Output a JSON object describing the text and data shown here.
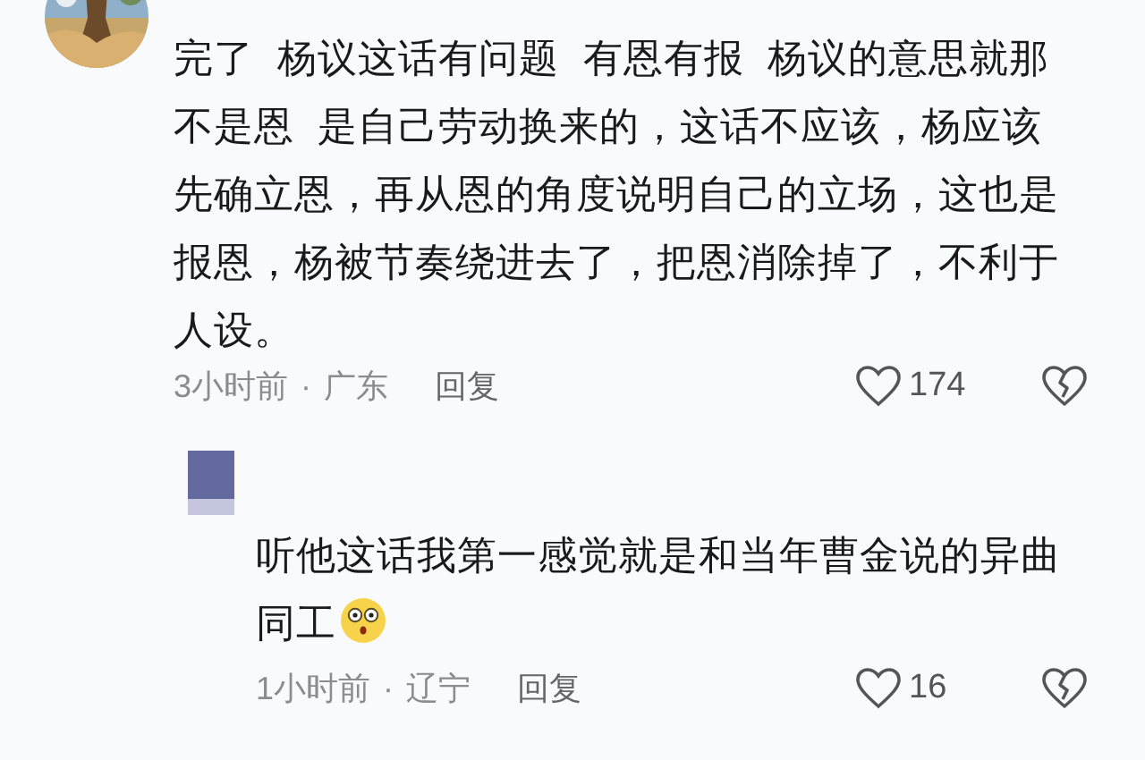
{
  "comments": [
    {
      "kind": "top",
      "text": "完了  杨议这话有问题  有恩有报  杨议的意思就那不是恩  是自己劳动换来的，这话不应该，杨应该先确立恩，再从恩的角度说明自己的立场，这也是报恩，杨被节奏绕进去了，把恩消除掉了，不利于人设。",
      "time": "3小时前",
      "separator": "·",
      "location": "广东",
      "reply": "回复",
      "likes": "174"
    },
    {
      "kind": "reply",
      "avatar": {
        "kind": "placeholder"
      },
      "text": "听他这话我第一感觉就是和当年曹金说的异曲同工",
      "emoji": true,
      "time": "1小时前",
      "separator": "·",
      "location": "辽宁",
      "reply": "回复",
      "likes": "16"
    }
  ]
}
